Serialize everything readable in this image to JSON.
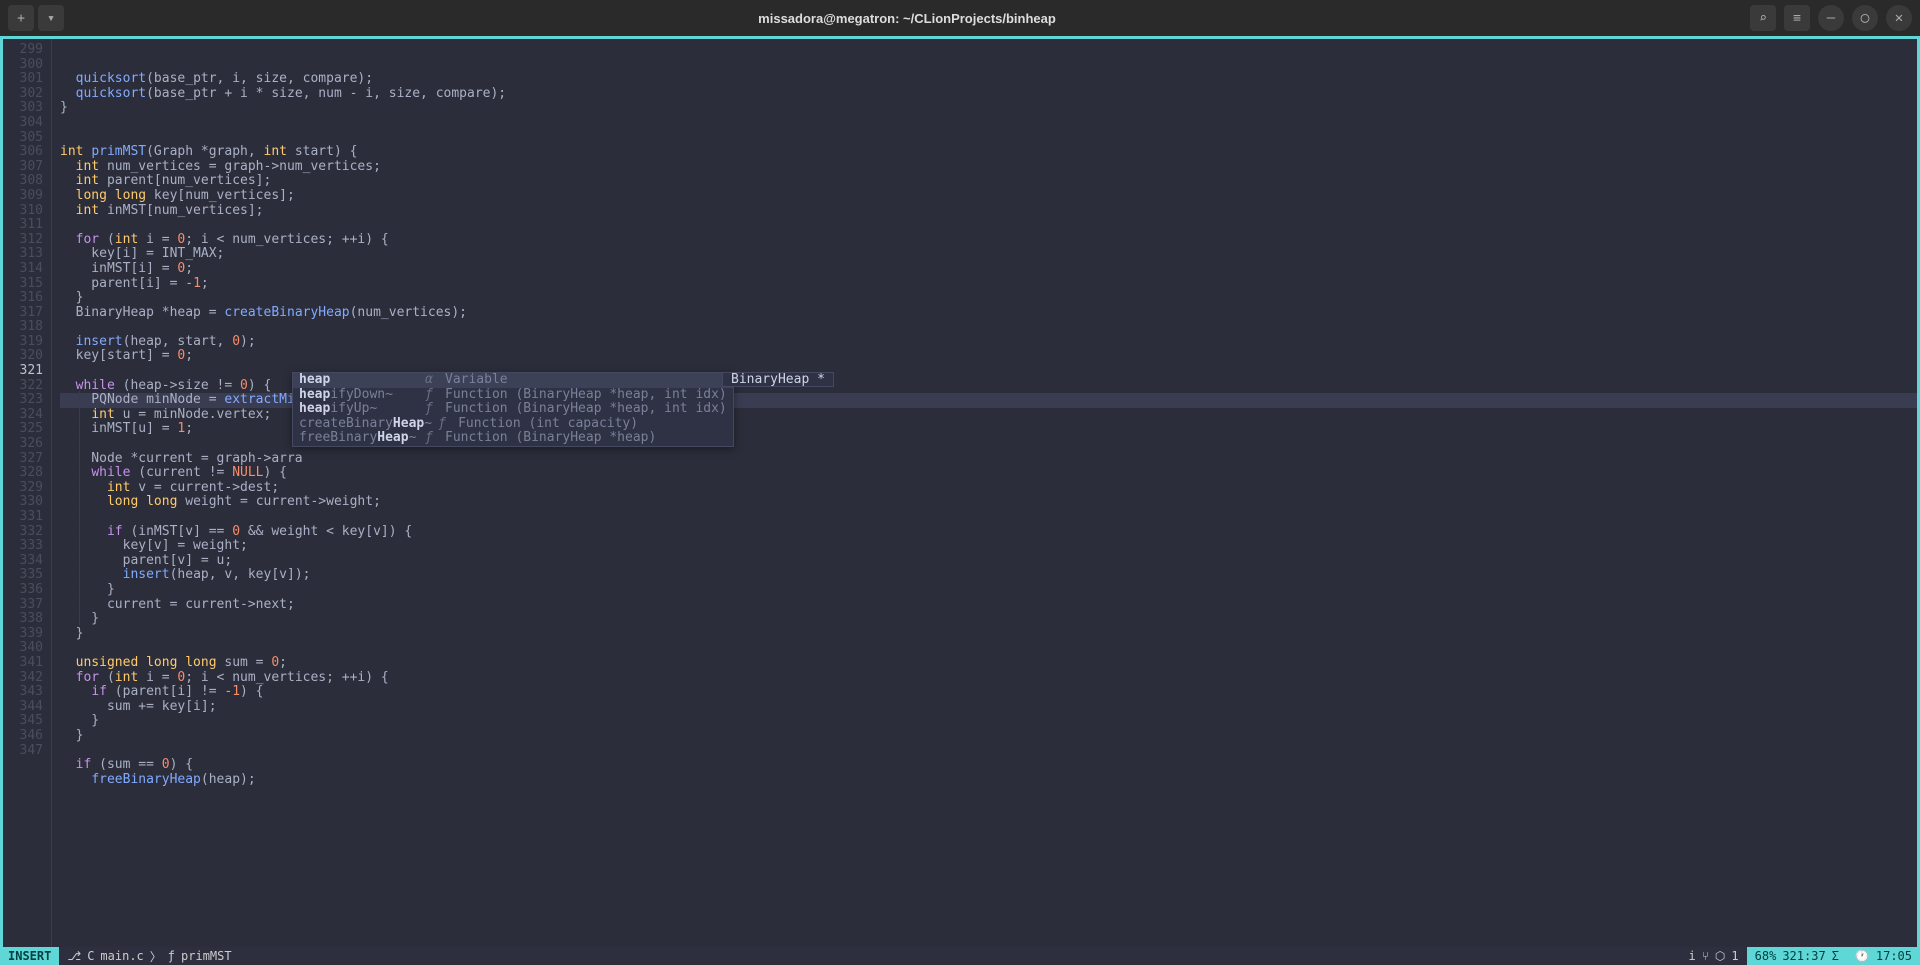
{
  "titlebar": {
    "title": "missadora@megatron: ~/CLionProjects/binheap",
    "plus": "+",
    "chevron": "▾",
    "search": "⌕",
    "menu": "≡",
    "min": "—",
    "max": "◯",
    "close": "✕"
  },
  "gutter": {
    "start": 299,
    "end": 347,
    "current": 321
  },
  "code_lines": [
    {
      "n": 299,
      "html": "  <span class='fn'>quicksort</span>(base_ptr, i, size, compare);"
    },
    {
      "n": 300,
      "html": "  <span class='fn'>quicksort</span>(base_ptr + i * size, num - i, size, compare);"
    },
    {
      "n": 301,
      "html": "}"
    },
    {
      "n": 302,
      "html": ""
    },
    {
      "n": 303,
      "html": ""
    },
    {
      "n": 304,
      "html": "<span class='ty'>int</span> <span class='fn'>primMST</span>(Graph *graph, <span class='ty'>int</span> start) {"
    },
    {
      "n": 305,
      "html": "  <span class='ty'>int</span> num_vertices = graph-&gt;num_vertices;"
    },
    {
      "n": 306,
      "html": "  <span class='ty'>int</span> parent[num_vertices];"
    },
    {
      "n": 307,
      "html": "  <span class='ty'>long long</span> key[num_vertices];"
    },
    {
      "n": 308,
      "html": "  <span class='ty'>int</span> inMST[num_vertices];"
    },
    {
      "n": 309,
      "html": ""
    },
    {
      "n": 310,
      "html": "  <span class='kw'>for</span> (<span class='ty'>int</span> i = <span class='num'>0</span>; i &lt; num_vertices; ++i) {"
    },
    {
      "n": 311,
      "html": "    key[i] = INT_MAX;"
    },
    {
      "n": 312,
      "html": "    inMST[i] = <span class='num'>0</span>;"
    },
    {
      "n": 313,
      "html": "    parent[i] = -<span class='num'>1</span>;"
    },
    {
      "n": 314,
      "html": "  }"
    },
    {
      "n": 315,
      "html": "  BinaryHeap *heap = <span class='fn'>createBinaryHeap</span>(num_vertices);"
    },
    {
      "n": 316,
      "html": ""
    },
    {
      "n": 317,
      "html": "  <span class='fn'>insert</span>(heap, start, <span class='num'>0</span>);"
    },
    {
      "n": 318,
      "html": "  key[start] = <span class='num'>0</span>;"
    },
    {
      "n": 319,
      "html": ""
    },
    {
      "n": 320,
      "html": "  <span class='kw'>while</span> (heap-&gt;size != <span class='num'>0</span>) {"
    },
    {
      "n": 321,
      "html": "  <span class='guide'>│</span> PQNode minNode = <span class='fn'>extractMin</span>(heap;",
      "hl": true
    },
    {
      "n": 322,
      "html": "  <span class='guide'>│</span> <span class='ty'>int</span> u = minNode.vertex;"
    },
    {
      "n": 323,
      "html": "  <span class='guide'>│</span> inMST[u] = <span class='num'>1</span>;"
    },
    {
      "n": 324,
      "html": "  <span class='guide'>│</span>"
    },
    {
      "n": 325,
      "html": "  <span class='guide'>│</span> Node *current = graph-&gt;arra"
    },
    {
      "n": 326,
      "html": "  <span class='guide'>│</span> <span class='kw'>while</span> (current != <span class='num'>NULL</span>) {"
    },
    {
      "n": 327,
      "html": "  <span class='guide'>│</span>   <span class='ty'>int</span> v = current-&gt;dest;"
    },
    {
      "n": 328,
      "html": "  <span class='guide'>│</span>   <span class='ty'>long long</span> weight = current-&gt;weight;"
    },
    {
      "n": 329,
      "html": "  <span class='guide'>│</span>"
    },
    {
      "n": 330,
      "html": "  <span class='guide'>│</span>   <span class='kw'>if</span> (inMST[v] == <span class='num'>0</span> &amp;&amp; weight &lt; key[v]) {"
    },
    {
      "n": 331,
      "html": "  <span class='guide'>│</span>     key[v] = weight;"
    },
    {
      "n": 332,
      "html": "  <span class='guide'>│</span>     parent[v] = u;"
    },
    {
      "n": 333,
      "html": "  <span class='guide'>│</span>     <span class='fn'>insert</span>(heap, v, key[v]);"
    },
    {
      "n": 334,
      "html": "  <span class='guide'>│</span>   }"
    },
    {
      "n": 335,
      "html": "  <span class='guide'>│</span>   current = current-&gt;next;"
    },
    {
      "n": 336,
      "html": "  <span class='guide'>│</span> }"
    },
    {
      "n": 337,
      "html": "  }"
    },
    {
      "n": 338,
      "html": ""
    },
    {
      "n": 339,
      "html": "  <span class='ty'>unsigned long long</span> sum = <span class='num'>0</span>;"
    },
    {
      "n": 340,
      "html": "  <span class='kw'>for</span> (<span class='ty'>int</span> i = <span class='num'>0</span>; i &lt; num_vertices; ++i) {"
    },
    {
      "n": 341,
      "html": "    <span class='kw'>if</span> (parent[i] != -<span class='num'>1</span>) {"
    },
    {
      "n": 342,
      "html": "      sum += key[i];"
    },
    {
      "n": 343,
      "html": "    }"
    },
    {
      "n": 344,
      "html": "  }"
    },
    {
      "n": 345,
      "html": ""
    },
    {
      "n": 346,
      "html": "  <span class='kw'>if</span> (sum == <span class='num'>0</span>) {"
    },
    {
      "n": 347,
      "html": "    <span class='fn'>freeBinaryHeap</span>(heap);"
    }
  ],
  "completion": {
    "items": [
      {
        "match": "heap",
        "rest": "",
        "kind": "α",
        "type": "Variable",
        "sel": true
      },
      {
        "match": "heap",
        "rest": "ifyDown~",
        "kind": "ƒ",
        "type": "Function (BinaryHeap *heap, int idx)"
      },
      {
        "match": "heap",
        "rest": "ifyUp~",
        "kind": "ƒ",
        "type": "Function (BinaryHeap *heap, int idx)"
      },
      {
        "prefix": "createBinary",
        "match": "Heap",
        "rest": "~",
        "kind": "ƒ",
        "type": "Function (int capacity)"
      },
      {
        "prefix": "freeBinary",
        "match": "Heap",
        "rest": "~",
        "kind": "ƒ",
        "type": "Function (BinaryHeap *heap)"
      }
    ],
    "extra": "BinaryHeap *"
  },
  "statusbar": {
    "mode": "INSERT",
    "branch_icon": "⎇",
    "file_icon": "C",
    "filename": "main.c",
    "sep": "〉",
    "fn_icon": "ƒ",
    "context": "primMST",
    "diag_i": "i",
    "diag_branch": "⑂",
    "diag_cube": "⬡",
    "diag_val": "1",
    "percent": "68%",
    "pos": "321:37",
    "sigma": "Σ",
    "clock_icon": "🕐",
    "clock": "17:05"
  }
}
